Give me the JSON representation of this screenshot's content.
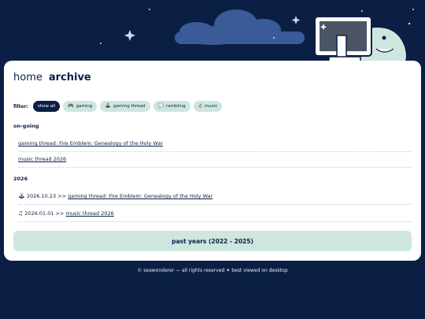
{
  "nav": {
    "home_label": "home",
    "archive_label": "archive"
  },
  "filter": {
    "label": "filter:",
    "chips": [
      {
        "label": "show all",
        "icon": "",
        "active": true
      },
      {
        "label": "gaming",
        "icon": "gamepad-icon",
        "active": false
      },
      {
        "label": "gaming thread",
        "icon": "joystick-icon",
        "active": false
      },
      {
        "label": "rambling",
        "icon": "speech-bubble-icon",
        "active": false
      },
      {
        "label": "music",
        "icon": "music-note-icon",
        "active": false
      }
    ]
  },
  "ongoing": {
    "heading": "on-going",
    "items": [
      {
        "label": "gaming thread: Fire Emblem: Genealogy of the Holy War"
      },
      {
        "label": "music thread 2026"
      }
    ]
  },
  "year_2026": {
    "heading": "2026",
    "entries": [
      {
        "icon": "joystick-icon",
        "date": "2026.10.23",
        "sep": ">>",
        "title": "gaming thread: Fire Emblem: Genealogy of the Holy War"
      },
      {
        "icon": "music-note-icon",
        "date": "2026.01.01",
        "sep": ">>",
        "title": "music thread 2026"
      }
    ]
  },
  "past_years_label": "past years (2022 - 2025)",
  "footer": "© seawonderer — all rights reserved ✦ best viewed on desktop",
  "colors": {
    "background": "#0b1f45",
    "card": "#ffffff",
    "chip": "#cfe6e0",
    "cloud": "#3a5a98"
  }
}
